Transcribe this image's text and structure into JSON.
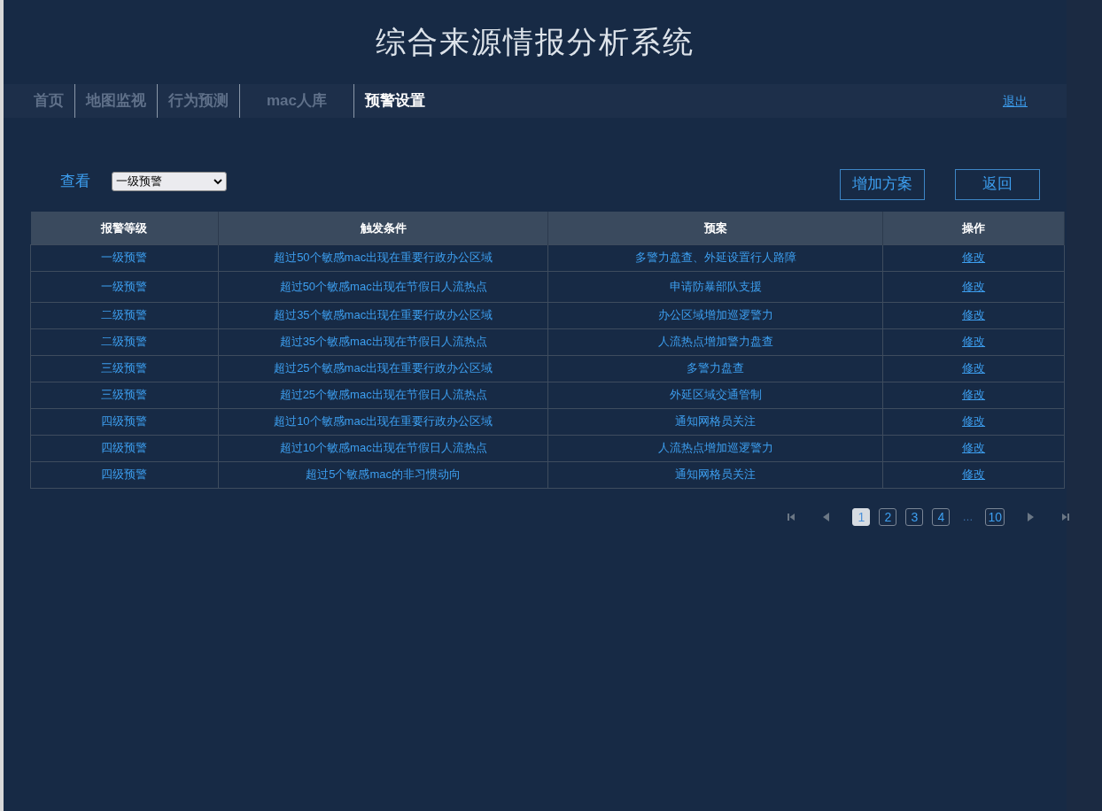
{
  "header": {
    "title": "综合来源情报分析系统"
  },
  "nav": {
    "tabs": [
      {
        "label": "首页",
        "selected": false
      },
      {
        "label": "地图监视",
        "selected": false
      },
      {
        "label": "行为预测",
        "selected": false
      },
      {
        "label": "mac人库",
        "selected": false
      },
      {
        "label": "预警设置",
        "selected": true
      }
    ],
    "logout": "退出"
  },
  "filter": {
    "label": "查看",
    "value": "一级预警"
  },
  "buttons": [
    "增加方案",
    "返回"
  ],
  "table": {
    "columns": [
      "报警等级",
      "触发条件",
      "预案",
      "操作"
    ],
    "rows": [
      [
        "一级预警",
        "超过50个敏感mac出现在重要行政办公区域",
        "多警力盘查、外延设置行人路障",
        "修改"
      ],
      [
        "一级预警",
        "超过50个敏感mac出现在节假日人流热点",
        "申请防暴部队支援",
        "修改"
      ],
      [
        "二级预警",
        "超过35个敏感mac出现在重要行政办公区域",
        "办公区域增加巡逻警力",
        "修改"
      ],
      [
        "二级预警",
        "超过35个敏感mac出现在节假日人流热点",
        "人流热点增加警力盘查",
        "修改"
      ],
      [
        "三级预警",
        "超过25个敏感mac出现在重要行政办公区域",
        "多警力盘查",
        "修改"
      ],
      [
        "三级预警",
        "超过25个敏感mac出现在节假日人流热点",
        "外延区域交通管制",
        "修改"
      ],
      [
        "四级预警",
        "超过10个敏感mac出现在重要行政办公区域",
        "通知网格员关注",
        "修改"
      ],
      [
        "四级预警",
        "超过10个敏感mac出现在节假日人流热点",
        "人流热点增加巡逻警力",
        "修改"
      ],
      [
        "四级预警",
        "超过5个敏感mac的非习惯动向",
        "通知网格员关注",
        "修改"
      ]
    ]
  },
  "pagination": {
    "pages": [
      {
        "label": "1",
        "selected": true
      },
      {
        "label": "2",
        "selected": false
      },
      {
        "label": "3",
        "selected": false
      },
      {
        "label": "4",
        "selected": false
      },
      {
        "label": "…",
        "kind": "ellipsis"
      },
      {
        "label": "10",
        "selected": false
      }
    ]
  }
}
